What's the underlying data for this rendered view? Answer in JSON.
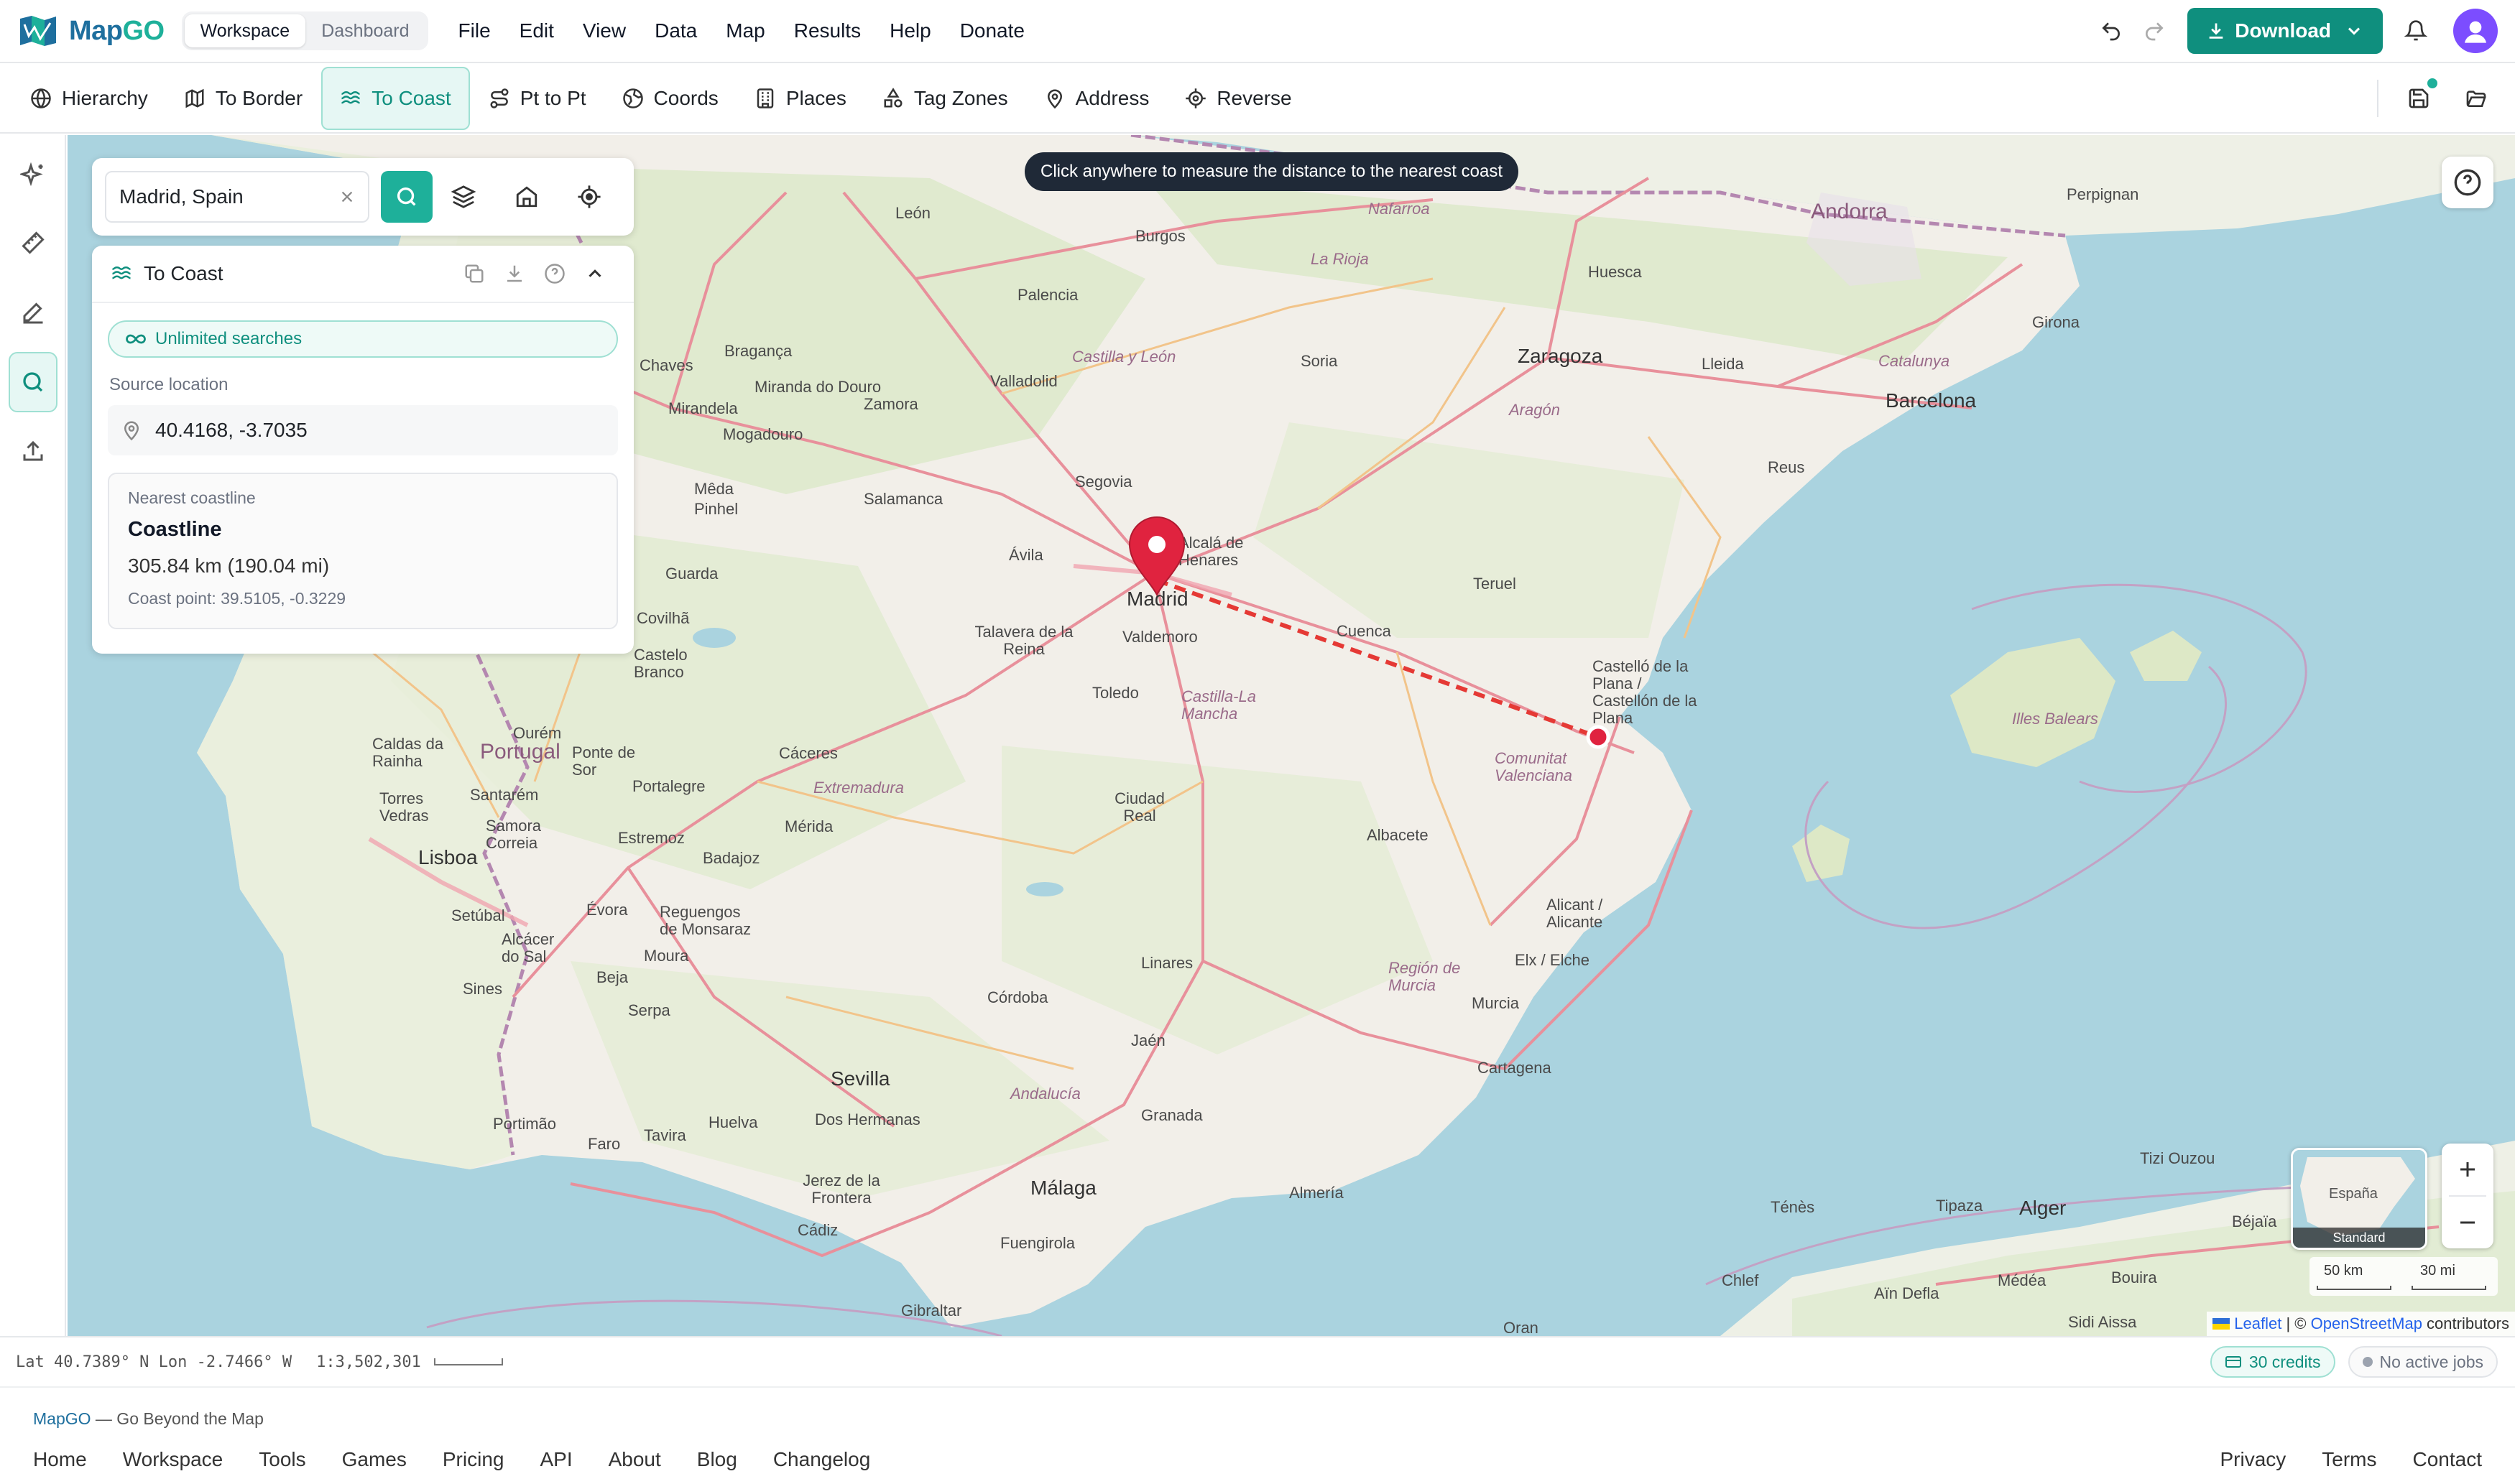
{
  "app": {
    "name_prefix": "Map",
    "name_suffix": "GO",
    "modes": [
      "Workspace",
      "Dashboard"
    ],
    "active_mode": "Workspace"
  },
  "menu": [
    "File",
    "Edit",
    "View",
    "Data",
    "Map",
    "Results",
    "Help",
    "Donate"
  ],
  "download_label": "Download",
  "tools": [
    {
      "label": "Hierarchy",
      "icon": "globe-icon"
    },
    {
      "label": "To Border",
      "icon": "map-icon"
    },
    {
      "label": "To Coast",
      "icon": "waves-icon",
      "active": true
    },
    {
      "label": "Pt to Pt",
      "icon": "route-icon"
    },
    {
      "label": "Coords",
      "icon": "compass-globe-icon"
    },
    {
      "label": "Places",
      "icon": "building-icon"
    },
    {
      "label": "Tag Zones",
      "icon": "shapes-icon"
    },
    {
      "label": "Address",
      "icon": "pin-icon"
    },
    {
      "label": "Reverse",
      "icon": "crosshair-icon"
    }
  ],
  "rail": [
    "sparkle-icon",
    "ruler-icon",
    "pencil-icon",
    "search-icon",
    "upload-icon"
  ],
  "map": {
    "hint": "Click anywhere to measure the distance to the nearest coast",
    "search_value": "Madrid, Spain",
    "labels": {
      "andorra": "Andorra",
      "perpignan": "Perpignan",
      "leon": "León",
      "burgos": "Burgos",
      "nafarroa": "Nafarroa",
      "la_rioja": "La Rioja",
      "huesca": "Huesca",
      "girona": "Girona",
      "palencia": "Palencia",
      "braganca": "Bragança",
      "chaves": "Chaves",
      "castilla_leon": "Castilla y León",
      "valladolid": "Valladolid",
      "soria": "Soria",
      "zaragoza": "Zaragoza",
      "lleida": "Lleida",
      "catalunya": "Catalunya",
      "barcelona": "Barcelona",
      "miranda": "Miranda do Douro",
      "mirandela": "Mirandela",
      "zamora": "Zamora",
      "mogadouro": "Mogadouro",
      "aragon": "Aragón",
      "reus": "Reus",
      "segovia": "Segovia",
      "salamanca": "Salamanca",
      "meda": "Mêda",
      "pinhel": "Pinhel",
      "avila": "Ávila",
      "alcala": "Alcalá de Henares",
      "madrid": "Madrid",
      "teruel": "Teruel",
      "guarda": "Guarda",
      "covilha": "Covilhã",
      "talavera": "Talavera de la Reina",
      "valdemoro": "Valdemoro",
      "cuenca": "Cuenca",
      "castelo_branco": "Castelo Branco",
      "toledo": "Toledo",
      "castilla_mancha": "Castilla-La Mancha",
      "castello": "Castelló de la Plana / Castellón de la Plana",
      "illes_balears": "Illes Balears",
      "ourem": "Ourém",
      "portugal": "Portugal",
      "ponte_sor": "Ponte de Sor",
      "caldas": "Caldas da Rainha",
      "caceres": "Cáceres",
      "comunitat": "Comunitat Valenciana",
      "extremadura": "Extremadura",
      "portalegre": "Portalegre",
      "torres": "Torres Vedras",
      "santarem": "Santarém",
      "samora": "Samora Correia",
      "ciudad_real": "Ciudad Real",
      "merida": "Mérida",
      "albacete": "Albacete",
      "estremoz": "Estremoz",
      "badajoz": "Badajoz",
      "lisboa": "Lisboa",
      "setubal": "Setúbal",
      "evora": "Évora",
      "reguengos": "Reguengos de Monsaraz",
      "alicante": "Alicant / Alicante",
      "alcacer": "Alcácer do Sal",
      "moura": "Moura",
      "linares": "Linares",
      "beja": "Beja",
      "elx": "Elx / Elche",
      "region_murcia": "Región de Murcia",
      "sines": "Sines",
      "serpa": "Serpa",
      "cordoba": "Córdoba",
      "murcia": "Murcia",
      "jaen": "Jaén",
      "cartagena": "Cartagena",
      "sevilla": "Sevilla",
      "andalucia": "Andalucía",
      "portimao": "Portimão",
      "faro": "Faro",
      "tavira": "Tavira",
      "huelva": "Huelva",
      "dos_hermanas": "Dos Hermanas",
      "granada": "Granada",
      "jerez": "Jerez de la Frontera",
      "malaga": "Málaga",
      "almeria": "Almería",
      "cadiz": "Cádiz",
      "fuengirola": "Fuengirola",
      "gibraltar": "Gibraltar",
      "tizi": "Tizi Ouzou",
      "tenes": "Ténès",
      "tipaza": "Tipaza",
      "alger": "Alger",
      "bejaia": "Béjaïa",
      "chlef": "Chlef",
      "ain_defla": "Aïn Defla",
      "medea": "Médéa",
      "bouira": "Bouira",
      "oran": "Oran",
      "sidi_aissa": "Sidi Aissa"
    },
    "minimap_label": "España",
    "minimap_style": "Standard",
    "scale_km": "50 km",
    "scale_mi": "30 mi",
    "attribution_leaflet": "Leaflet",
    "attribution_sep": " | © ",
    "attribution_osm": "OpenStreetMap",
    "attribution_rest": " contributors",
    "colors": {
      "accent": "#1eb09a",
      "marker": "#e0233f",
      "line": "#e53935"
    }
  },
  "panel": {
    "title": "To Coast",
    "badge": "Unlimited searches",
    "source_label": "Source location",
    "source_value": "40.4168, -3.7035",
    "result_label": "Nearest coastline",
    "result_name": "Coastline",
    "result_distance": "305.84 km (190.04 mi)",
    "result_point": "Coast point: 39.5105, -0.3229"
  },
  "status": {
    "coords": "Lat 40.7389° N Lon -2.7466° W",
    "scale_ratio": "1:3,502,301",
    "credits": "30 credits",
    "jobs": "No active jobs"
  },
  "footer": {
    "brand": "MapGO",
    "tagline_rest": " — Go Beyond the Map",
    "links": [
      "Home",
      "Workspace",
      "Tools",
      "Games",
      "Pricing",
      "API",
      "About",
      "Blog",
      "Changelog"
    ],
    "right_links": [
      "Privacy",
      "Terms",
      "Contact"
    ]
  }
}
